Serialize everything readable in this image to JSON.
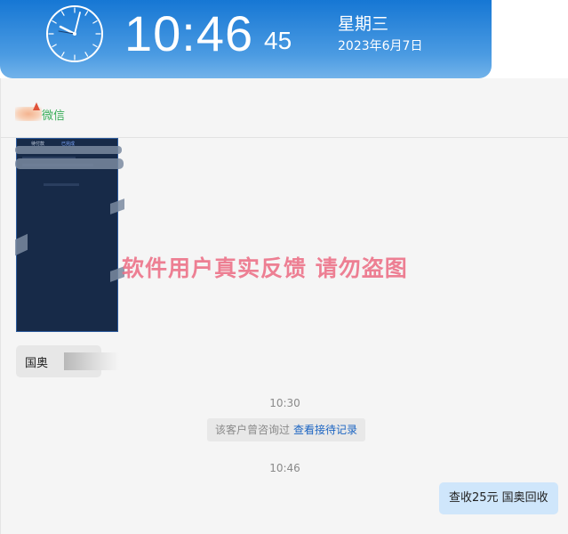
{
  "clock": {
    "time": "10:46",
    "seconds": "45",
    "weekday": "星期三",
    "date": "2023年6月7日"
  },
  "chat": {
    "source_label": "微信",
    "screenshot": {
      "tab_left": "待付款",
      "tab_right": "已完成"
    },
    "watermark": "软件用户真实反馈  请勿盗图",
    "incoming_message": "国奥",
    "timestamp_1": "10:30",
    "notice_text": "该客户曾咨询过",
    "notice_link": "查看接待记录",
    "timestamp_2": "10:46",
    "outgoing_message": "查收25元 国奥回收"
  },
  "colors": {
    "banner_top": "#1677d4",
    "banner_bottom": "#73b3ea",
    "watermark": "#ec6f86",
    "outgoing_bubble": "#cfe6fb",
    "link": "#1b64c2"
  }
}
